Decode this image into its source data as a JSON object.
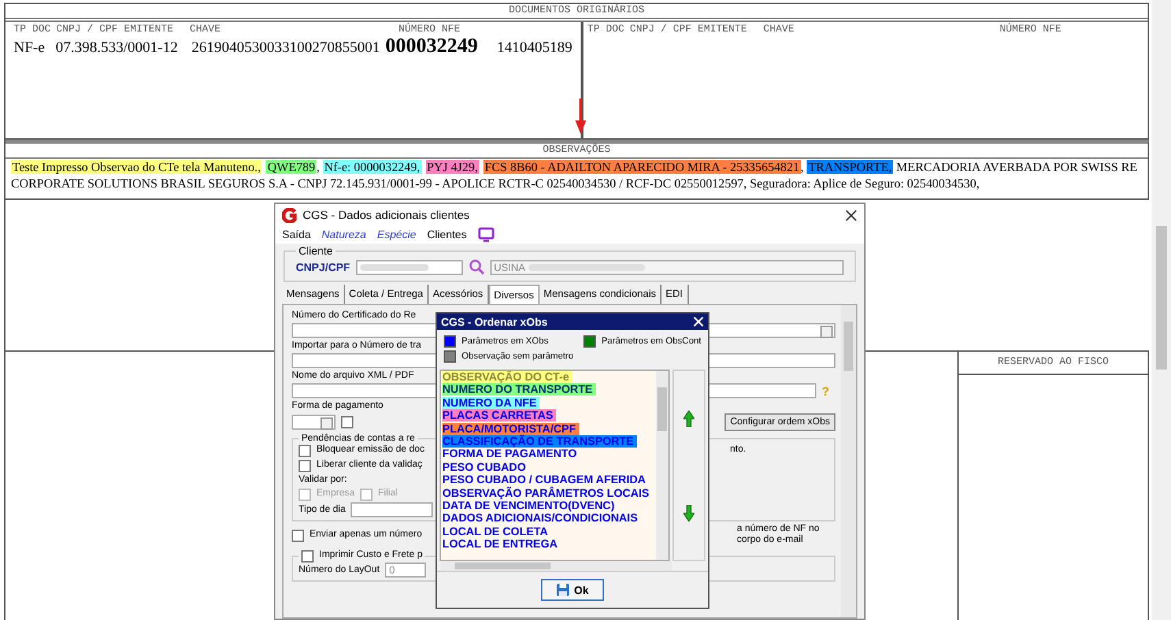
{
  "document": {
    "originals": {
      "title": "DOCUMENTOS ORIGINÁRIOS",
      "panels": [
        {
          "columns": [
            "TP DOC",
            "CNPJ / CPF EMITENTE",
            "CHAVE",
            "NÚMERO NFE"
          ],
          "row": [
            "NF-e",
            "07.398.533/0001-12",
            "2619040530033100270855001",
            "000032249",
            "1410405189"
          ]
        },
        {
          "columns": [
            "TP DOC",
            "CNPJ / CPF EMITENTE",
            "CHAVE",
            "NÚMERO NFE"
          ]
        }
      ]
    },
    "observations": {
      "title": "OBSERVAÇÕES",
      "segments": [
        {
          "text": "Teste Impresso Observao do CTe tela Manuteno.,",
          "color": "#ffff80"
        },
        {
          "text": "QWE789",
          "color": "#80ff80"
        },
        {
          "text": ", "
        },
        {
          "text": "Nf-e: 0000032249,",
          "color": "#80ffff"
        },
        {
          "text": "PYJ 4J29,",
          "color": "#ff80c0"
        },
        {
          "text": "FCS 8B60 - ADAILTON APARECIDO MIRA - 25335654821",
          "color": "#ff8040"
        },
        {
          "text": ", "
        },
        {
          "text": "TRANSPORTE,",
          "color": "#0080ff"
        },
        {
          "text": " MERCADORIA AVERBADA POR SWISS RE CORPORATE SOLUTIONS BRASIL SEGUROS S.A - CNPJ 72.145.931/0001-99 - APOLICE RCTR-C 02540034530 / RCF-DC 02550012597, Seguradora:  Aplice de Seguro: 02540034530,"
        }
      ]
    },
    "fiscal": {
      "title": "RESERVADO AO FISCO"
    }
  },
  "client_dialog": {
    "title": "CGS - Dados adicionais clientes",
    "menu": [
      {
        "label": "Saída",
        "kind": "plain"
      },
      {
        "label": "Natureza",
        "kind": "link"
      },
      {
        "label": "Espécie",
        "kind": "link"
      },
      {
        "label": "Clientes",
        "kind": "plain"
      }
    ],
    "group": "Cliente",
    "cnpj_label": "CNPJ/CPF",
    "name_value": "USINA",
    "tabs": [
      {
        "label": "Mensagens",
        "selected": false
      },
      {
        "label": "Coleta / Entrega",
        "selected": false
      },
      {
        "label": "Acessórios",
        "selected": false
      },
      {
        "label": "Diversos",
        "selected": true
      },
      {
        "label": "Mensagens condicionais",
        "selected": false
      },
      {
        "label": "EDI",
        "selected": false
      }
    ],
    "cert_label": "Número do Certificado do Re",
    "import_label": "Importar para o Número de tra",
    "xml_label": "Nome do arquivo XML / PDF",
    "help_icon": "?",
    "payment_label": "Forma de pagamento",
    "payment_check": {
      "checked": false
    },
    "config_button": "Configurar ordem xObs",
    "pending_group": "Pendências de contas a re",
    "pending_checks": [
      {
        "label": "Bloquear emissão de doc",
        "checked": false
      },
      {
        "label": "Liberar cliente da validaç",
        "checked": false
      }
    ],
    "pending_note": "nto.",
    "validate_label": "Validar por:",
    "validate_checks": [
      {
        "label": "Empresa",
        "checked": false,
        "disabled": true
      },
      {
        "label": "Filial",
        "checked": false,
        "disabled": true
      }
    ],
    "day_type_label": "Tipo de dia",
    "send_check": {
      "label": "Enviar apenas um número",
      "checked": false
    },
    "send_note": "a número de NF no corpo do e-mail",
    "print_check": {
      "label": "Imprimir Custo e Frete p",
      "checked": false
    },
    "layout_label": "Número do LayOut",
    "layout_value": "0"
  },
  "order_dialog": {
    "title": "CGS - Ordenar xObs",
    "legend": [
      {
        "label": "Parâmetros em XObs",
        "color": "#0000ff"
      },
      {
        "label": "Parâmetros em ObsCont",
        "color": "#008000"
      },
      {
        "label": "Observação sem parâmetro",
        "color": "#808080"
      }
    ],
    "items": [
      {
        "label": "OBSERVAÇÃO DO CT-e",
        "kind": "noparam",
        "color": "#ffff80"
      },
      {
        "label": "NUMERO DO TRANSPORTE",
        "kind": "obscont",
        "color": "#80ff80"
      },
      {
        "label": "NUMERO DA NFE",
        "kind": "xobs",
        "color": "#80ffff"
      },
      {
        "label": "PLACAS CARRETAS",
        "kind": "xobs",
        "color": "#ff80c0"
      },
      {
        "label": "PLACA/MOTORISTA/CPF",
        "kind": "xobs",
        "color": "#ff8040"
      },
      {
        "label": "CLASSIFICAÇÃO DE TRANSPORTE",
        "kind": "xobs",
        "color": "#0080ff"
      },
      {
        "label": "FORMA DE PAGAMENTO",
        "kind": "xobs"
      },
      {
        "label": "PESO CUBADO",
        "kind": "xobs"
      },
      {
        "label": "PESO CUBADO / CUBAGEM AFERIDA",
        "kind": "xobs"
      },
      {
        "label": "OBSERVAÇÃO PARÂMETROS LOCAIS",
        "kind": "xobs"
      },
      {
        "label": "DATA DE VENCIMENTO(DVENC)",
        "kind": "xobs"
      },
      {
        "label": "DADOS ADICIONAIS/CONDICIONAIS",
        "kind": "xobs"
      },
      {
        "label": "LOCAL DE COLETA",
        "kind": "xobs"
      },
      {
        "label": "LOCAL DE ENTREGA",
        "kind": "xobs"
      }
    ],
    "ok_button": "Ok"
  }
}
